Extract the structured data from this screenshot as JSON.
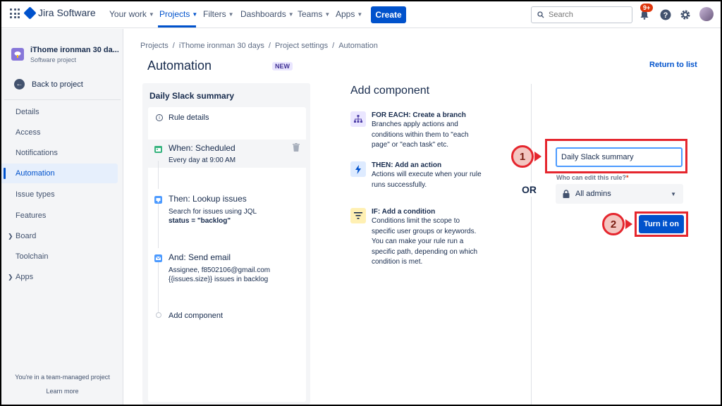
{
  "topnav": {
    "product": "Jira Software",
    "items": [
      {
        "label": "Your work"
      },
      {
        "label": "Projects"
      },
      {
        "label": "Filters"
      },
      {
        "label": "Dashboards"
      },
      {
        "label": "Teams"
      },
      {
        "label": "Apps"
      }
    ],
    "active_item": "Projects",
    "create_label": "Create",
    "search_placeholder": "Search",
    "notification_badge": "9+"
  },
  "sidebar": {
    "project_name": "iThome ironman 30 da...",
    "project_type": "Software project",
    "back_label": "Back to project",
    "items": [
      {
        "label": "Details"
      },
      {
        "label": "Access"
      },
      {
        "label": "Notifications"
      },
      {
        "label": "Automation"
      },
      {
        "label": "Issue types"
      },
      {
        "label": "Features"
      },
      {
        "label": "Board"
      },
      {
        "label": "Toolchain"
      },
      {
        "label": "Apps"
      }
    ],
    "active_item": "Automation",
    "footer_text": "You're in a team-managed project",
    "learn_more": "Learn more"
  },
  "breadcrumb": [
    "Projects",
    "/",
    "iThome ironman 30 days",
    "/",
    "Project settings",
    "/",
    "Automation"
  ],
  "page": {
    "title": "Automation",
    "new_lozenge": "NEW",
    "return_link": "Return to list"
  },
  "rule": {
    "name": "Daily Slack summary",
    "rule_details": "Rule details",
    "when_title": "When: Scheduled",
    "when_desc": "Every day at 9:00 AM",
    "then_title": "Then: Lookup issues",
    "then_desc": "Search for issues using JQL",
    "then_query": "status = \"backlog\"",
    "and_title": "And: Send email",
    "and_desc1": "Assignee, f8502106@gmail.com",
    "and_desc2": "{{issues.size}} issues in backlog",
    "add_component": "Add component"
  },
  "add_component": {
    "title": "Add component",
    "items": [
      {
        "head": "FOR EACH: Create a branch",
        "desc": "Branches apply actions and conditions within them to \"each page\" or \"each task\" etc."
      },
      {
        "head": "THEN: Add an action",
        "desc": "Actions will execute when your rule runs successfully."
      },
      {
        "head": "IF: Add a condition",
        "desc": "Conditions limit the scope to specific user groups or keywords. You can make your rule run a specific path, depending on which condition is met."
      }
    ]
  },
  "or_label": "OR",
  "form": {
    "rule_name_value": "Daily Slack summary",
    "who_label": "Who can edit this rule?",
    "who_required": "*",
    "who_value": "All admins",
    "turn_on_label": "Turn it on"
  },
  "markers": [
    "1",
    "2"
  ],
  "colors": {
    "brand": "#0052cc",
    "annotation": "#e5262e"
  }
}
